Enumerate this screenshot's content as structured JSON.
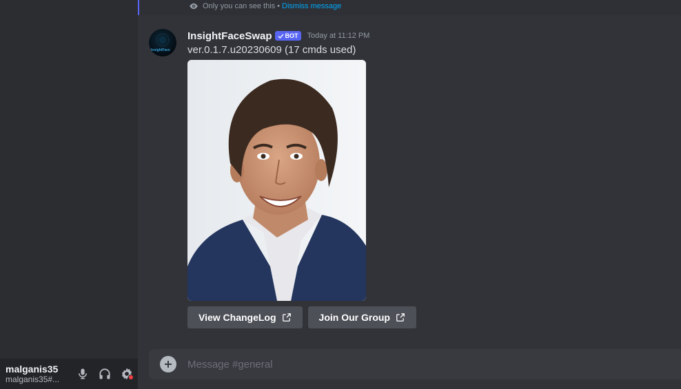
{
  "ephemeral": {
    "notice": "Only you can see this",
    "separator": "•",
    "dismiss_label": "Dismiss message"
  },
  "message": {
    "author": "InsightFaceSwap",
    "avatar_text": "InsightFace",
    "bot_badge": "BOT",
    "timestamp": "Today at 11:12 PM",
    "content": "ver.0.1.7.u20230609 (17 cmds used)",
    "buttons": [
      {
        "label": "View ChangeLog",
        "icon": "external-link-icon"
      },
      {
        "label": "Join Our Group",
        "icon": "external-link-icon"
      }
    ]
  },
  "composer": {
    "placeholder": "Message #general"
  },
  "user_panel": {
    "username": "malganis35",
    "tag": "malganis35#...",
    "icons": [
      "microphone-icon",
      "headphones-icon",
      "settings-icon"
    ]
  },
  "colors": {
    "background": "#313338",
    "sidebar": "#2b2d31",
    "accent": "#5865f2",
    "link": "#00a8fc",
    "button": "#4e5058",
    "status_red": "#f23f43"
  }
}
